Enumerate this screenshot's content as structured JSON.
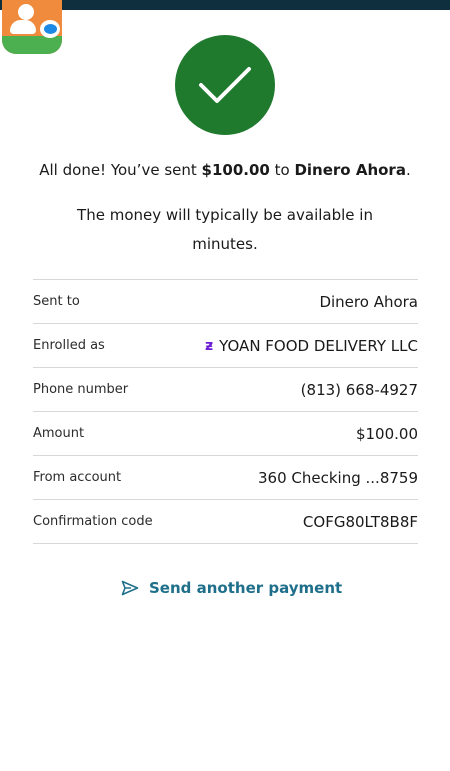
{
  "header": {
    "bar_color": "#0f2f3f"
  },
  "status": {
    "icon": "check-icon",
    "color": "#1f7a2e"
  },
  "message": {
    "prefix": "All done! You’ve sent ",
    "amount": "$100.00",
    "mid": " to ",
    "recipient": "Dinero Ahora",
    "suffix": ".",
    "availability": "The money will typically be available in minutes."
  },
  "details": [
    {
      "label": "Sent to",
      "value": "Dinero Ahora"
    },
    {
      "label": "Enrolled as",
      "value": "YOAN FOOD DELIVERY LLC",
      "icon": "zelle-icon"
    },
    {
      "label": "Phone number",
      "value": "(813) 668-4927"
    },
    {
      "label": "Amount",
      "value": "$100.00"
    },
    {
      "label": "From account",
      "value": "360 Checking ...8759"
    },
    {
      "label": "Confirmation code",
      "value": "COFG80LT8B8F"
    }
  ],
  "actions": {
    "send_another": "Send another payment",
    "accent": "#1f6f8b"
  }
}
